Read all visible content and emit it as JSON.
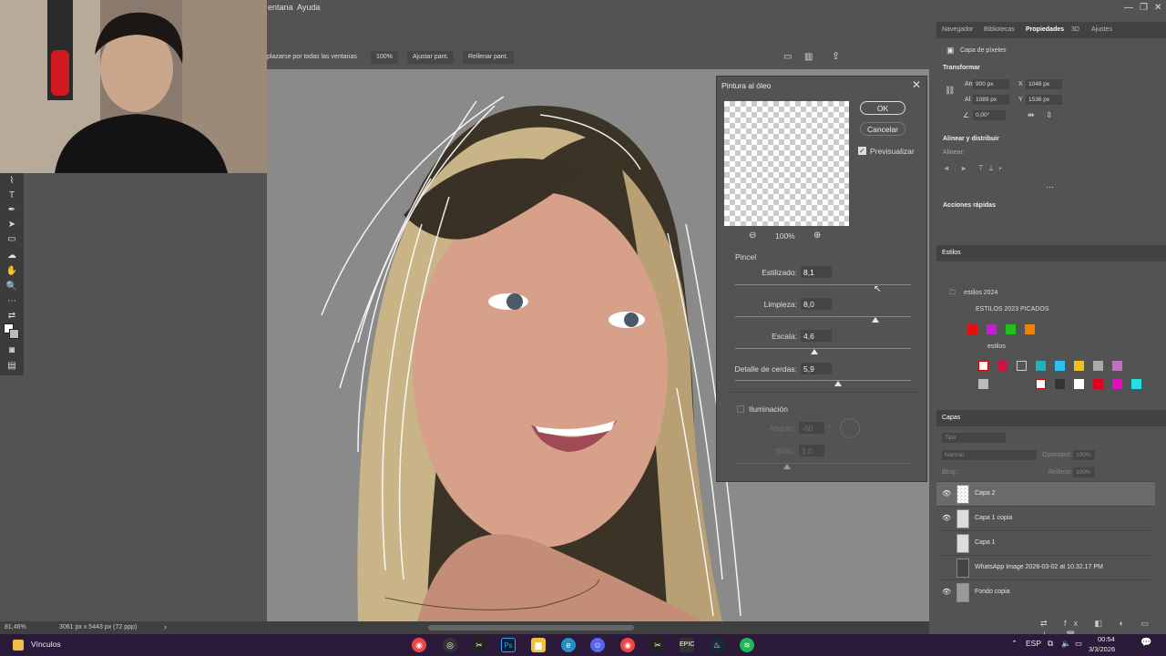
{
  "menu": {
    "ventana": "Ventana",
    "ayuda": "Ayuda",
    "partial_ventana": "entana"
  },
  "options_bar": {
    "scroll_all": "plazarse por todas las ventanas",
    "zoom": "100%",
    "fit": "Ajustar pant.",
    "fill": "Rellenar pant."
  },
  "dialog": {
    "title": "Pintura al óleo",
    "ok": "OK",
    "cancel": "Cancelar",
    "preview_label": "Previsualizar",
    "preview_checked": true,
    "zoom": "100%",
    "brush_section": "Pincel",
    "sliders": [
      {
        "label": "Estilizado:",
        "value": "8,1",
        "level": 0.81
      },
      {
        "label": "Limpieza:",
        "value": "8,0",
        "level": 0.8
      },
      {
        "label": "Escala:",
        "value": "4,6",
        "level": 0.44
      },
      {
        "label": "Detalle de cerdas:",
        "value": "5,9",
        "level": 0.59
      }
    ],
    "lighting": {
      "label": "Iluminación",
      "checked": false,
      "angle_label": "Ángulo:",
      "angle_value": "-60",
      "angle_unit": "°",
      "brightness_label": "Brillo:",
      "brightness_value": "1,0"
    }
  },
  "right_panel": {
    "tabs": [
      "Navegador",
      "Bibliotecas",
      "Propiedades",
      "3D",
      "Ajustes"
    ],
    "active_tab": "Propiedades",
    "layer_kind": "Capa de píxeles",
    "transform": {
      "heading": "Transformar",
      "w_label": "An",
      "w": "900 px",
      "x_label": "X",
      "x": "1048 px",
      "h_label": "Al",
      "h": "1089 px",
      "y_label": "Y",
      "y": "1536 px",
      "angle": "0,00°"
    },
    "align_heading": "Alinear y distribuir",
    "align_sub": "Alinear:",
    "quick_actions": "Acciones rápidas",
    "styles_tab": "Estilos",
    "styles_tree": [
      "estilos 2024",
      "ESTILOS 2023 PICADOS",
      "estilos"
    ],
    "swatch_colors": [
      "#e01010",
      "#c020d0",
      "#20c020",
      "#f08000"
    ],
    "layers_tab": "Capas",
    "layers_filter": "Tipo",
    "blend_mode": "Normal",
    "opacity_label": "Opacidad:",
    "opacity": "100%",
    "lock_label": "Bloq.:",
    "fill_label": "Relleno:",
    "fill": "100%",
    "layers": [
      {
        "name": "Capa 2",
        "visible": true,
        "selected": true
      },
      {
        "name": "Capa 1 copia",
        "visible": true,
        "selected": false
      },
      {
        "name": "Capa 1",
        "visible": false,
        "selected": false
      },
      {
        "name": "WhatsApp Image 2026-03-02 at 10.32.17 PM",
        "visible": false,
        "selected": false
      },
      {
        "name": "Fondo copia",
        "visible": true,
        "selected": false
      }
    ]
  },
  "status": {
    "zoom": "81,46%",
    "doc_size": "3061 px x 5443 px (72 ppp)"
  },
  "taskbar": {
    "left_label": "Vínculos",
    "lang": "ESP",
    "time": "00:54",
    "date": "3/3/2026"
  }
}
